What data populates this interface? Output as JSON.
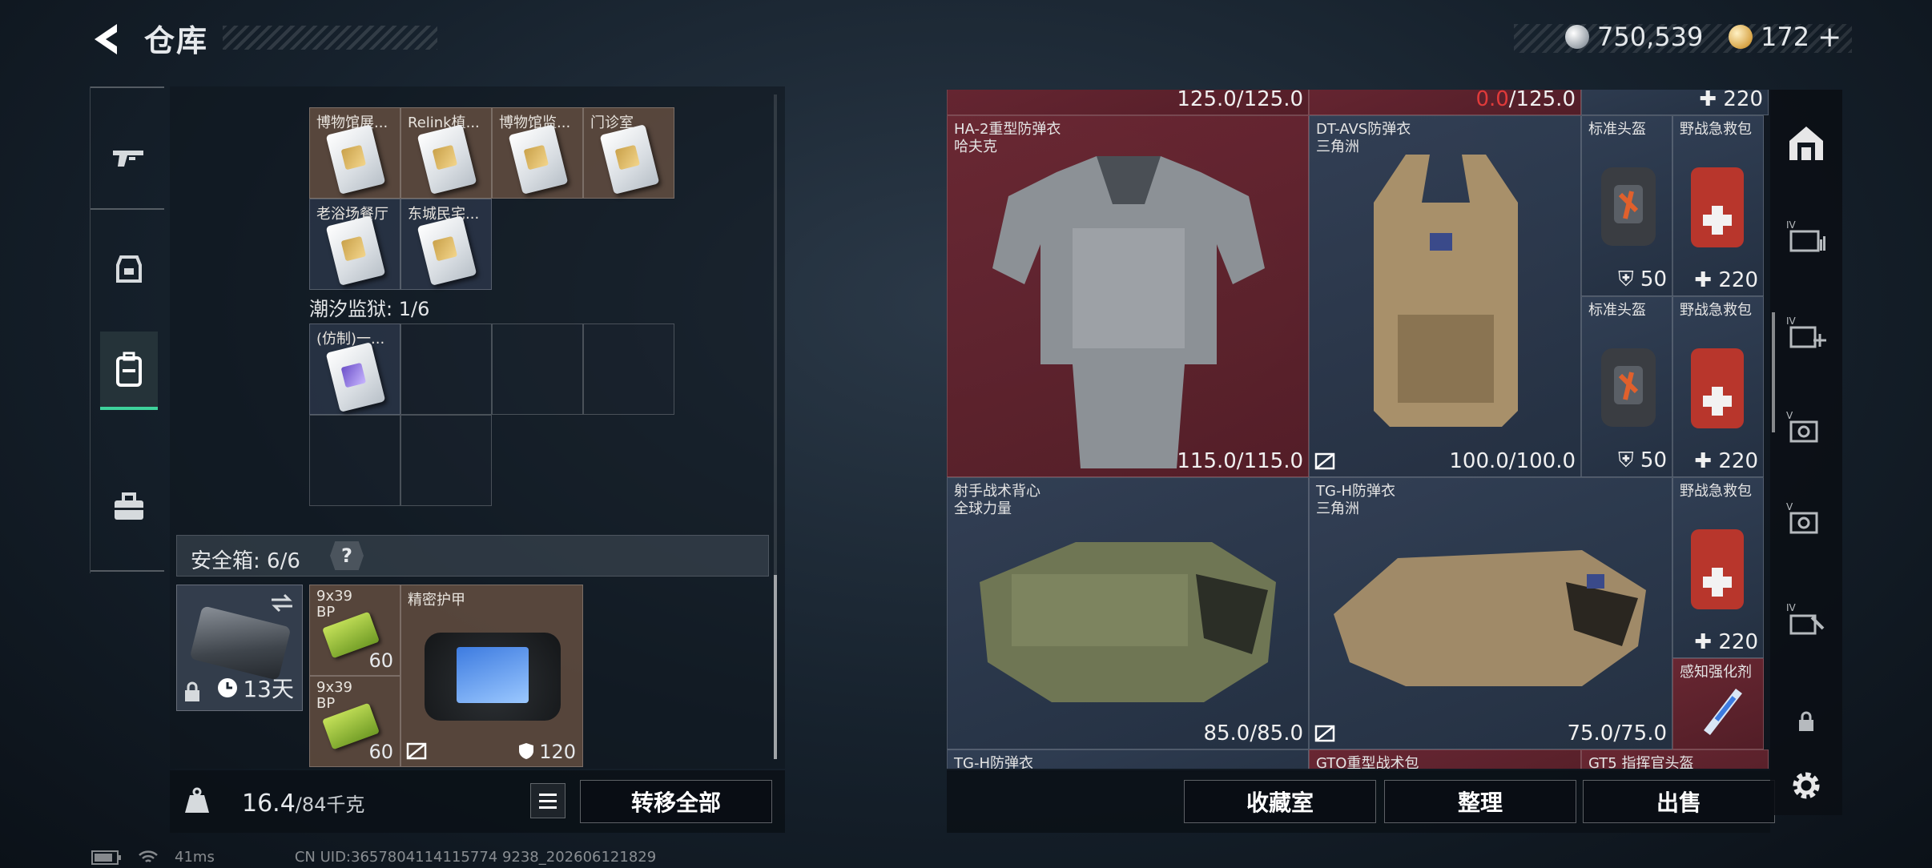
{
  "header": {
    "title": "仓库",
    "currency_silver": "750,539",
    "currency_gold": "172",
    "gold_add": "+"
  },
  "nav": {
    "items": [
      "weapon-icon",
      "helmet-icon",
      "backpack-icon",
      "toolbox-icon"
    ],
    "active": "backpack-icon"
  },
  "left": {
    "cards_row1": [
      "博物馆展...",
      "Relink植...",
      "博物馆监...",
      "门诊室"
    ],
    "cards_row2": [
      "老浴场餐厅",
      "东城民宅..."
    ],
    "prison_section": "潮汐监狱: 1/6",
    "prison_item": "(仿制)一...",
    "safe_box": {
      "label": "安全箱: 6/6",
      "help": "?",
      "timer": "13天"
    },
    "ammo1": {
      "label": "9x39\nBP",
      "count": "60"
    },
    "ammo2": {
      "label": "9x39\nBP",
      "count": "60"
    },
    "bag": {
      "label": "精密护甲",
      "count": "120"
    },
    "weight": "16.4",
    "weight_max": "/84千克",
    "transfer_all": "转移全部"
  },
  "stash": {
    "top_row": [
      "125.0/125.0",
      "0.0",
      "/125.0",
      "220"
    ],
    "items": [
      {
        "name": "HA-2重型防弹衣\n哈夫克",
        "dur": "115.0/115.0"
      },
      {
        "name": "DT-AVS防弹衣\n三角洲",
        "dur": "100.0/100.0"
      },
      {
        "name": "标准头盔",
        "dur": "50"
      },
      {
        "name": "野战急救包",
        "dur": "220"
      },
      {
        "name": "标准头盔",
        "dur": "50"
      },
      {
        "name": "野战急救包",
        "dur": "220"
      },
      {
        "name": "射手战术背心\n全球力量",
        "dur": "85.0/85.0"
      },
      {
        "name": "TG-H防弹衣\n三角洲",
        "dur": "75.0/75.0"
      },
      {
        "name": "野战急救包",
        "dur": "220"
      },
      {
        "name": "感知强化剂",
        "dur": ""
      }
    ],
    "bottom_row": [
      "TG-H防弹衣",
      "GTO重型战术包",
      "GT5 指挥官头盔"
    ],
    "buttons": {
      "collection": "收藏室",
      "sort": "整理",
      "sell": "出售"
    }
  },
  "status": {
    "ping": "41ms",
    "uid": "CN UID:3657804114115774 9238_202606121829"
  },
  "colors": {
    "accent": "#3ed29b",
    "red_cell": "#702834",
    "blue_cell": "#344258",
    "brown_cell": "#6a5242"
  }
}
